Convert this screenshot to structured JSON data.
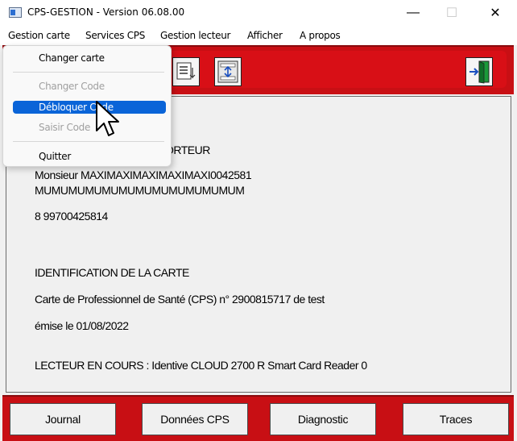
{
  "window": {
    "title": "CPS-GESTION - Version 06.08.00",
    "minimize_glyph": "—",
    "maximize_glyph": "☐",
    "close_glyph": "✕"
  },
  "menubar": {
    "items": [
      "Gestion carte",
      "Services CPS",
      "Gestion lecteur",
      "Afficher",
      "A propos"
    ]
  },
  "dropdown": {
    "items": [
      {
        "label": "Changer carte",
        "enabled": true
      },
      {
        "label": "Changer Code",
        "enabled": false
      },
      {
        "label": "Débloquer Code",
        "enabled": true,
        "highlighted": true
      },
      {
        "label": "Saisir Code",
        "enabled": false
      },
      {
        "label": "Quitter",
        "enabled": true
      }
    ]
  },
  "toolbar": {
    "icons": [
      "card-reader-icon",
      "transfer-icon",
      "exit-door-icon"
    ]
  },
  "panel": {
    "holder_heading": "ORTEUR",
    "holder_name": "Monsieur MAXIMAXIMAXIMAXIMAXI0042581",
    "holder_surname": "MUMUMUMUMUMUMUMUMUMUMUMUM",
    "holder_id": "8 99700425814",
    "card_heading": "IDENTIFICATION DE LA CARTE",
    "card_desc": "Carte de Professionnel de Santé (CPS) n° 2900815717 de test",
    "card_issued": "émise le 01/08/2022",
    "reader": "LECTEUR EN COURS : Identive CLOUD 2700 R Smart Card Reader 0"
  },
  "buttons": [
    "Journal",
    "Données CPS",
    "Diagnostic",
    "Traces"
  ],
  "colors": {
    "toolbar_red": "#c80f14",
    "highlight_blue": "#0a64d8"
  }
}
